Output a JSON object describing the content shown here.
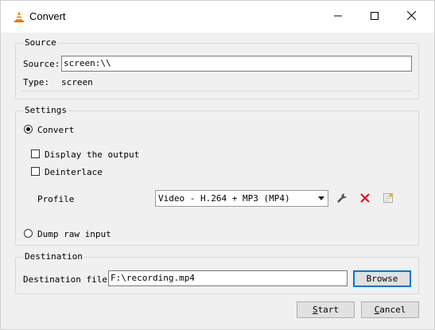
{
  "window": {
    "title": "Convert",
    "icon": "vlc-cone-icon"
  },
  "source": {
    "group_title": "Source",
    "source_label": "Source:",
    "source_value": "screen:\\\\",
    "type_label": "Type:",
    "type_value": "screen"
  },
  "settings": {
    "group_title": "Settings",
    "convert_label": "Convert",
    "convert_selected": true,
    "display_output_label": "Display the output",
    "display_output_checked": false,
    "deinterlace_label": "Deinterlace",
    "deinterlace_checked": false,
    "profile_label": "Profile",
    "profile_value": "Video - H.264 + MP3 (MP4)",
    "dump_raw_label": "Dump raw input",
    "dump_raw_selected": false
  },
  "destination": {
    "group_title": "Destination",
    "file_label": "Destination file:",
    "file_value": "F:\\recording.mp4",
    "browse_label": "Browse"
  },
  "buttons": {
    "start_first": "S",
    "start_rest": "tart",
    "cancel_first": "C",
    "cancel_rest": "ancel"
  },
  "colors": {
    "accent": "#0078d7",
    "delete_red": "#e81123"
  }
}
